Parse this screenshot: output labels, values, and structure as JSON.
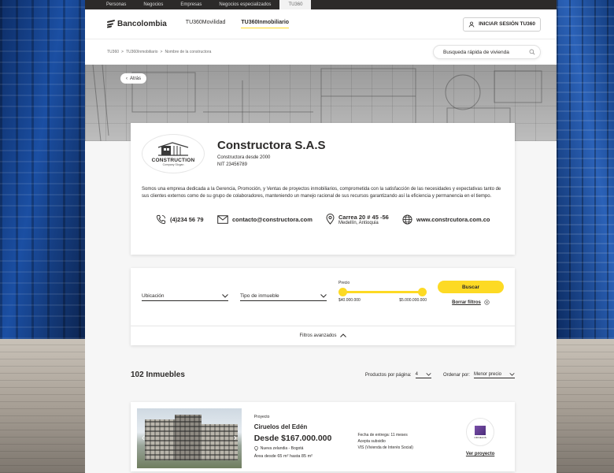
{
  "topbar": {
    "items": [
      "Personas",
      "Negocios",
      "Empresas",
      "Negocios especializados",
      "TU360"
    ]
  },
  "header": {
    "logo_text": "Bancolombia",
    "nav": [
      "TU360Movilidad",
      "TU360Inmobiliario"
    ],
    "login_label": "INICIAR SESIÓN TU360"
  },
  "breadcrumb": {
    "items": [
      "TU360",
      "TU360Inmobiliario",
      "Nombre de la constructora"
    ],
    "separator": ">"
  },
  "quick_search": {
    "placeholder": "Busqueda rápida de vivienda"
  },
  "hero": {
    "back_label": "Atrás"
  },
  "company": {
    "logo_word": "CONSTRUCTION",
    "logo_sub": "Company Slogan",
    "name": "Constructora S.A.S",
    "since": "Constructora desde 2000",
    "nit": "NIT 23456789",
    "description": "Somos una empresa dedicada a la Gerencia, Promoción, y Ventas de proyectos inmobiliarios, comprometida con la satisfacción de las necesidades y expectativas tanto de sus clientes externos como de su grupo de colaboradores, manteniendo un manejo racional de sus recursos garantizando así la eficiencia y permanencia en el tiempo.",
    "phone": "(4)234 56 79",
    "email": "contacto@constructora.com",
    "address": "Carrea 20 # 45 -56",
    "city": "Medellín, Antioquia",
    "website": "www.constrcutora.com.co"
  },
  "search": {
    "location_label": "Ubicación",
    "type_label": "Tipo de inmueble",
    "price_label": "Precio",
    "price_min": "$40.000.000",
    "price_max": "$5.000.000.000",
    "search_button": "Buscar",
    "clear_label": "Borrar filtros",
    "advanced_label": "Filtros avanzados"
  },
  "results": {
    "count_label": "102 Inmuebles",
    "per_page_label": "Productos por página:",
    "per_page_value": "4",
    "order_label": "Ordenar por:",
    "order_value": "Menor precio"
  },
  "property": {
    "kind": "Proyecto",
    "name": "Ciruelos del Edén",
    "price": "Desde $167.000.000",
    "location": "Nueva zelandia - Bogotá",
    "area": "Área desde  65 m² hasta 85 m²",
    "delivery": "Fecha de entrega: 11 meses",
    "subsidy": "Acepta subsidio",
    "vis": "VIS (Vivienda de Interés Social)",
    "builder_name": "CIRUELOS",
    "view_label": "Ver proyecto"
  },
  "colors": {
    "accent_yellow": "#fdda24",
    "text_dark": "#2c2a29",
    "topbar_bg": "#2c2a29"
  }
}
